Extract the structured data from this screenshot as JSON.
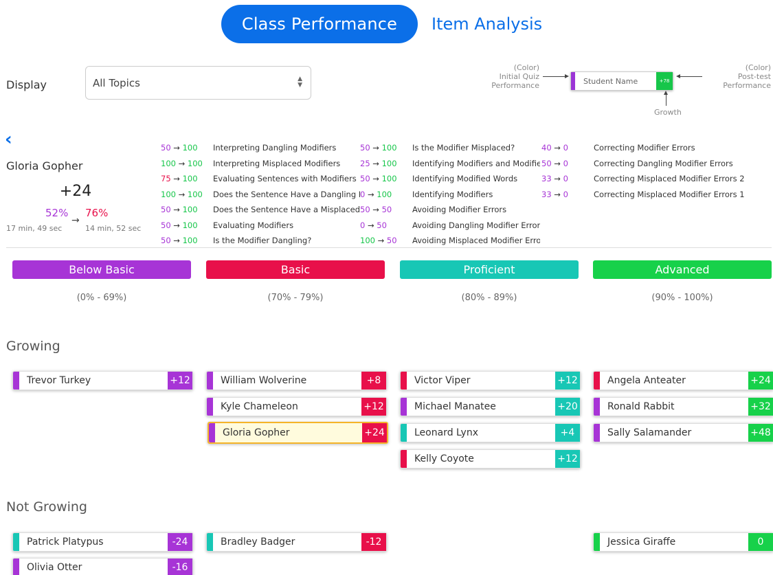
{
  "tabs": {
    "active": "Class Performance",
    "other": "Item Analysis"
  },
  "display": {
    "label": "Display",
    "selected": "All Topics"
  },
  "legend": {
    "initial": "(Color)\nInitial Quiz\nPerformance",
    "initial_l1": "(Color)",
    "initial_l2": "Initial Quiz",
    "initial_l3": "Performance",
    "post_l1": "(Color)",
    "post_l2": "Post-test",
    "post_l3": "Performance",
    "card_name": "Student Name",
    "card_score": "+78",
    "growth": "Growth"
  },
  "student": {
    "name": "Gloria Gopher",
    "growth": "+24",
    "pre_pct": "52%",
    "post_pct": "76%",
    "arrow": "→",
    "pre_time": "17 min, 49 sec",
    "post_time": "14 min, 52 sec"
  },
  "topics": {
    "col1": [
      {
        "pre": "50",
        "post": "100",
        "pre_c": "pur",
        "post_c": "grn",
        "name": "Interpreting Dangling Modifiers"
      },
      {
        "pre": "100",
        "post": "100",
        "pre_c": "grn",
        "post_c": "grn",
        "name": "Interpreting Misplaced Modifiers"
      },
      {
        "pre": "75",
        "post": "100",
        "pre_c": "red",
        "post_c": "grn",
        "name": "Evaluating Sentences with Modifiers"
      },
      {
        "pre": "100",
        "post": "100",
        "pre_c": "grn",
        "post_c": "grn",
        "name": "Does the Sentence Have a Dangling Modifier?"
      },
      {
        "pre": "50",
        "post": "100",
        "pre_c": "pur",
        "post_c": "grn",
        "name": "Does the Sentence Have a Misplaced Modifier?"
      },
      {
        "pre": "50",
        "post": "100",
        "pre_c": "pur",
        "post_c": "grn",
        "name": "Evaluating Modifiers"
      },
      {
        "pre": "50",
        "post": "100",
        "pre_c": "pur",
        "post_c": "grn",
        "name": "Is the Modifier Dangling?"
      }
    ],
    "col2": [
      {
        "pre": "50",
        "post": "100",
        "pre_c": "pur",
        "post_c": "grn",
        "name": "Is the Modifier Misplaced?"
      },
      {
        "pre": "25",
        "post": "100",
        "pre_c": "pur",
        "post_c": "grn",
        "name": "Identifying Modifiers and Modified Words"
      },
      {
        "pre": "50",
        "post": "100",
        "pre_c": "pur",
        "post_c": "grn",
        "name": "Identifying Modified Words"
      },
      {
        "pre": "0",
        "post": "100",
        "pre_c": "pur",
        "post_c": "grn",
        "name": "Identifying Modifiers"
      },
      {
        "pre": "50",
        "post": "50",
        "pre_c": "pur",
        "post_c": "pur",
        "name": "Avoiding Modifier Errors"
      },
      {
        "pre": "0",
        "post": "50",
        "pre_c": "pur",
        "post_c": "pur",
        "name": "Avoiding Dangling Modifier Errors"
      },
      {
        "pre": "100",
        "post": "50",
        "pre_c": "grn",
        "post_c": "pur",
        "name": "Avoiding Misplaced Modifier Errors"
      }
    ],
    "col3": [
      {
        "pre": "40",
        "post": "0",
        "pre_c": "pur",
        "post_c": "pur",
        "name": "Correcting Modifier Errors"
      },
      {
        "pre": "50",
        "post": "0",
        "pre_c": "pur",
        "post_c": "pur",
        "name": "Correcting Dangling Modifier Errors"
      },
      {
        "pre": "33",
        "post": "0",
        "pre_c": "pur",
        "post_c": "pur",
        "name": "Correcting Misplaced Modifier Errors 2"
      },
      {
        "pre": "33",
        "post": "0",
        "pre_c": "pur",
        "post_c": "pur",
        "name": "Correcting Misplaced Modifier Errors 1"
      }
    ]
  },
  "levels": [
    {
      "label": "Below Basic",
      "range": "(0% - 69%)",
      "color": "#a734d6"
    },
    {
      "label": "Basic",
      "range": "(70% - 79%)",
      "color": "#e8104a"
    },
    {
      "label": "Proficient",
      "range": "(80% - 89%)",
      "color": "#18c7b5"
    },
    {
      "label": "Advanced",
      "range": "(90% - 100%)",
      "color": "#17d14a"
    }
  ],
  "sections": {
    "growing": "Growing",
    "not_growing": "Not Growing"
  },
  "growing": [
    [
      {
        "name": "Trevor Turkey",
        "g": "+12",
        "bar": "p",
        "gc": "p"
      }
    ],
    [
      {
        "name": "William Wolverine",
        "g": "+8",
        "bar": "p",
        "gc": "r"
      },
      {
        "name": "Kyle Chameleon",
        "g": "+12",
        "bar": "p",
        "gc": "r"
      },
      {
        "name": "Gloria Gopher",
        "g": "+24",
        "bar": "p",
        "gc": "r",
        "selected": true
      }
    ],
    [
      {
        "name": "Victor Viper",
        "g": "+12",
        "bar": "r",
        "gc": "t"
      },
      {
        "name": "Michael Manatee",
        "g": "+20",
        "bar": "p",
        "gc": "t"
      },
      {
        "name": "Leonard Lynx",
        "g": "+4",
        "bar": "t",
        "gc": "t"
      },
      {
        "name": "Kelly Coyote",
        "g": "+12",
        "bar": "r",
        "gc": "t"
      }
    ],
    [
      {
        "name": "Angela Anteater",
        "g": "+24",
        "bar": "r",
        "gc": "g"
      },
      {
        "name": "Ronald Rabbit",
        "g": "+32",
        "bar": "p",
        "gc": "g"
      },
      {
        "name": "Sally Salamander",
        "g": "+48",
        "bar": "p",
        "gc": "g"
      }
    ]
  ],
  "not_growing": [
    [
      {
        "name": "Patrick Platypus",
        "g": "-24",
        "bar": "t",
        "gc": "p"
      },
      {
        "name": "Olivia Otter",
        "g": "-16",
        "bar": "p",
        "gc": "p"
      }
    ],
    [
      {
        "name": "Bradley Badger",
        "g": "-12",
        "bar": "t",
        "gc": "r"
      }
    ],
    [],
    [
      {
        "name": "Jessica Giraffe",
        "g": "0",
        "bar": "g",
        "gc": "g"
      }
    ]
  ]
}
